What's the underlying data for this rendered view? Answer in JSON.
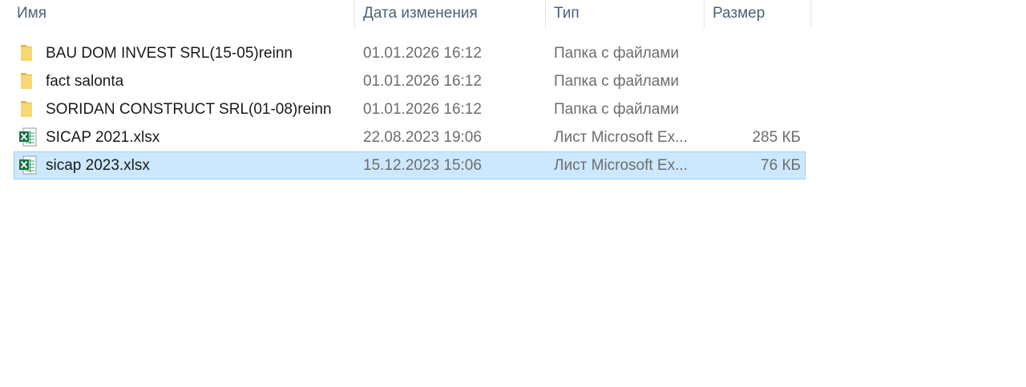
{
  "columns": {
    "name": "Имя",
    "date": "Дата изменения",
    "type": "Тип",
    "size": "Размер"
  },
  "files": [
    {
      "name": "BAU DOM INVEST SRL(15-05)reinn",
      "date": "01.01.2026 16:12",
      "type": "Папка с файлами",
      "size": "",
      "icon": "folder-icon",
      "selected": false
    },
    {
      "name": "fact salonta",
      "date": "01.01.2026 16:12",
      "type": "Папка с файлами",
      "size": "",
      "icon": "folder-icon",
      "selected": false
    },
    {
      "name": "SORIDAN CONSTRUCT SRL(01-08)reinn",
      "date": "01.01.2026 16:12",
      "type": "Папка с файлами",
      "size": "",
      "icon": "folder-icon",
      "selected": false
    },
    {
      "name": "SICAP 2021.xlsx",
      "date": "22.08.2023 19:06",
      "type": "Лист Microsoft Ex...",
      "size": "285 КБ",
      "icon": "excel-file-icon",
      "selected": false
    },
    {
      "name": "sicap 2023.xlsx",
      "date": "15.12.2023 15:06",
      "type": "Лист Microsoft Ex...",
      "size": "76 КБ",
      "icon": "excel-file-icon",
      "selected": true
    }
  ],
  "colors": {
    "selection_bg": "#cce8ff",
    "selection_border": "#99d1ff",
    "folder": "#f8d775",
    "excel": "#1d6f42"
  }
}
